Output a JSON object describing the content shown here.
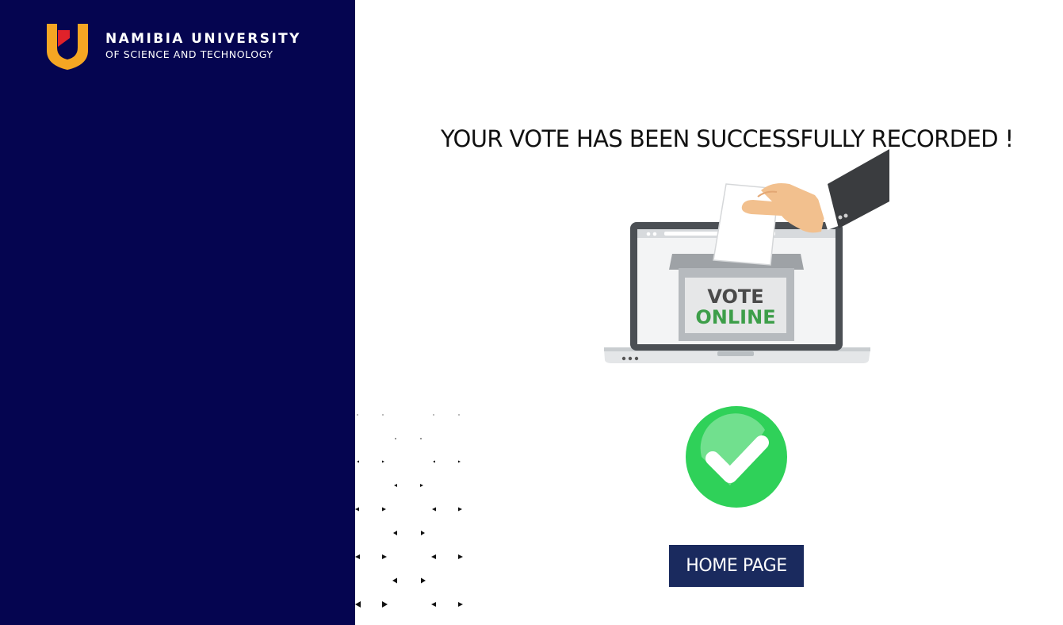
{
  "brand": {
    "name_line1": "NAMIBIA UNIVERSITY",
    "name_line2": "OF SCIENCE AND TECHNOLOGY",
    "colors": {
      "sidebar": "#050550",
      "shield_orange": "#f5a623",
      "shield_red": "#e0222a"
    }
  },
  "main": {
    "headline": "YOUR VOTE HAS BEEN SUCCESSFULLY RECORDED !",
    "illustration": {
      "icon": "vote-online-laptop",
      "box_line1": "VOTE",
      "box_line2": "ONLINE"
    },
    "status_icon": "check-circle-icon",
    "status_color": "#2fd159",
    "home_button": "HOME PAGE",
    "button_color": "#1a2a5e"
  }
}
